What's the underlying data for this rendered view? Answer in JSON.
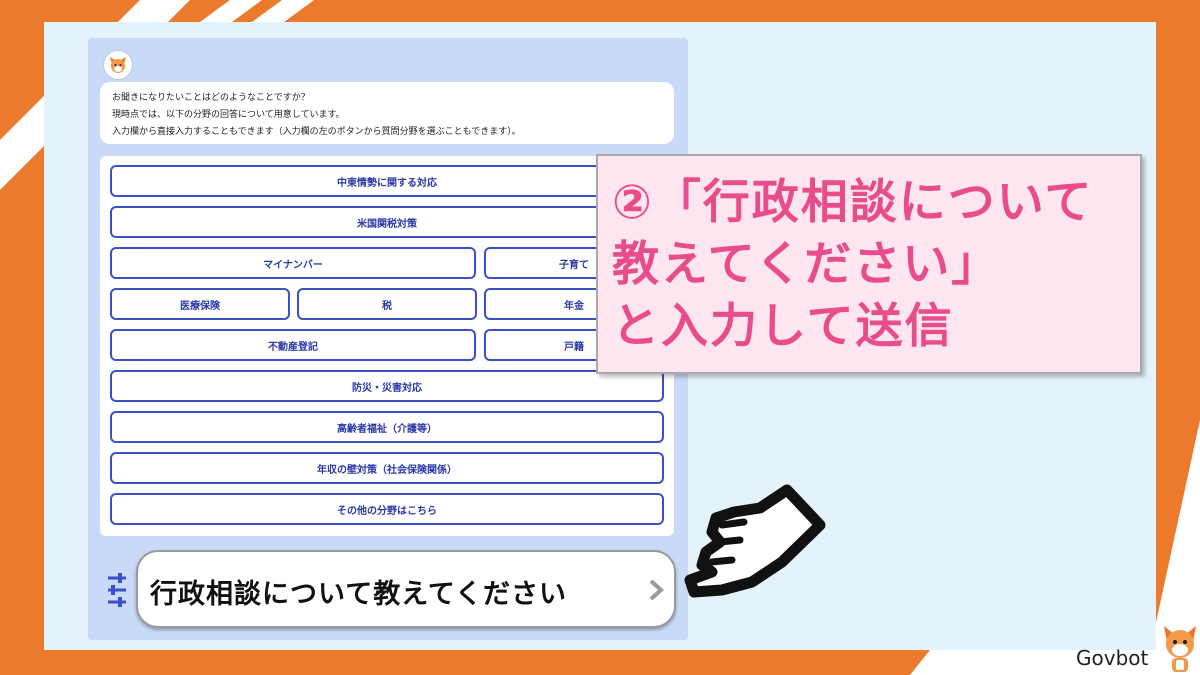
{
  "colors": {
    "orange": "#ec7a2c",
    "panel": "#e4f3fb",
    "chat_bg": "#c8daf8",
    "button_border": "#3b4fc6",
    "callout_text": "#e84c8a",
    "callout_bg": "#fde6ef"
  },
  "bot_message": {
    "line1": "お聞きになりたいことはどのようなことですか？",
    "line2": "現時点では、以下の分野の回答について用意しています。",
    "line3": "入力欄から直接入力することもできます（入力欄の左のボタンから質問分野を選ぶこともできます）。"
  },
  "choices": {
    "middle_east": "中東情勢に関する対応",
    "us_tariff": "米国関税対策",
    "mynumber": "マイナンバー",
    "childcare": "子育て",
    "medical": "医療保険",
    "tax": "税",
    "pension": "年金",
    "real_estate": "不動産登記",
    "family_register": "戸籍",
    "disaster": "防災・災害対応",
    "elderly": "高齢者福祉（介護等）",
    "income_wall": "年収の壁対策（社会保険関係）",
    "other": "その他の分野はこちら"
  },
  "input": {
    "value": "行政相談について教えてください"
  },
  "callout": {
    "text": "②「行政相談について\n教えてください」\nと入力して送信"
  },
  "brand": {
    "name": "Govbot"
  },
  "icons": {
    "avatar": "bot-avatar-icon",
    "settings": "settings-sliders-icon",
    "send": "send-chevron-icon",
    "pointer": "pointing-hand-icon"
  }
}
